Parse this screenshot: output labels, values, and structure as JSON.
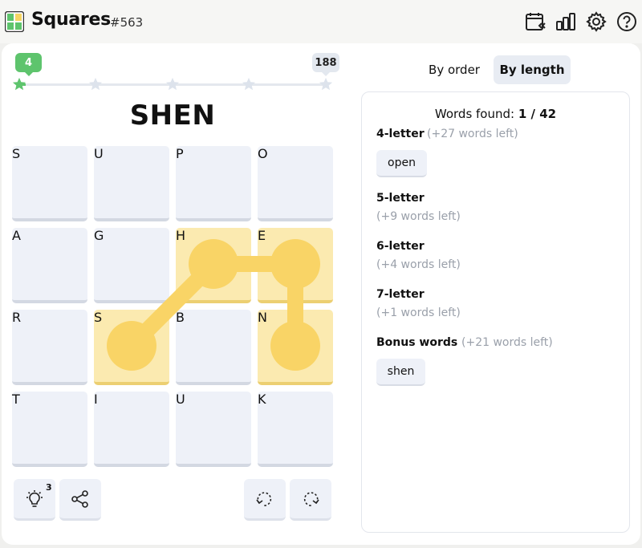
{
  "header": {
    "title": "Squares",
    "puzzle_number": "#563",
    "icons": [
      "calendar-back-icon",
      "stats-bar-chart-icon",
      "settings-gear-icon",
      "help-question-icon"
    ]
  },
  "progress": {
    "score": "4",
    "max": "188",
    "fraction": 0.021
  },
  "current_word": "SHEN",
  "grid": [
    [
      "S",
      "U",
      "P",
      "O"
    ],
    [
      "A",
      "G",
      "H",
      "E"
    ],
    [
      "R",
      "S",
      "B",
      "N"
    ],
    [
      "T",
      "I",
      "U",
      "K"
    ]
  ],
  "selected_path": [
    [
      2,
      1
    ],
    [
      1,
      2
    ],
    [
      1,
      3
    ],
    [
      2,
      3
    ]
  ],
  "tools": {
    "hints_left": "3",
    "icons": [
      "lightbulb-icon",
      "share-icon",
      "undo-icon",
      "redo-icon"
    ]
  },
  "view_toggle": {
    "by_order": "By order",
    "by_length": "By length",
    "active": "by_length"
  },
  "words": {
    "found_label": "Words found:",
    "found_count": "1 / 42",
    "groups": [
      {
        "title": "4-letter",
        "left": "(+27 words left)",
        "words": [
          "open"
        ]
      },
      {
        "title": "5-letter",
        "left": "(+9 words left)",
        "words": []
      },
      {
        "title": "6-letter",
        "left": "(+4 words left)",
        "words": []
      },
      {
        "title": "7-letter",
        "left": "(+1 words left)",
        "words": []
      },
      {
        "title": "Bonus words",
        "left": "(+21 words left)",
        "words": [
          "shen"
        ]
      }
    ]
  },
  "colors": {
    "accent_green": "#5ec46d",
    "tile": "#eef1f8",
    "tile_selected": "#fbeab0",
    "path": "#f9d466"
  }
}
